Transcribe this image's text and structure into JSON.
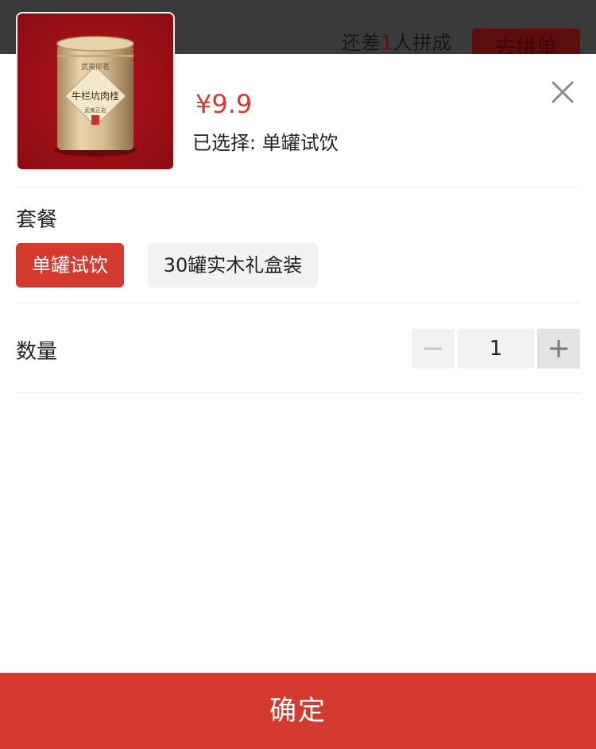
{
  "background_page": {
    "group_status_prefix": "还差",
    "group_status_number": "1",
    "group_status_suffix": "人拼成",
    "group_button_label": "去拼单"
  },
  "sheet": {
    "price": "¥9.9",
    "selected_text": "已选择: 单罐试饮",
    "close_icon": "close-icon",
    "package": {
      "label": "套餐",
      "options": [
        {
          "label": "单罐试饮",
          "selected": true
        },
        {
          "label": "30罐实木礼盒装",
          "selected": false
        }
      ]
    },
    "quantity": {
      "label": "数量",
      "value": "1",
      "minus_icon": "minus-icon",
      "plus_icon": "plus-icon"
    },
    "confirm_label": "确定"
  },
  "colors": {
    "accent": "#d53a2f",
    "option_inactive_bg": "#f2f2f2",
    "backdrop": "#3a3a3a"
  }
}
